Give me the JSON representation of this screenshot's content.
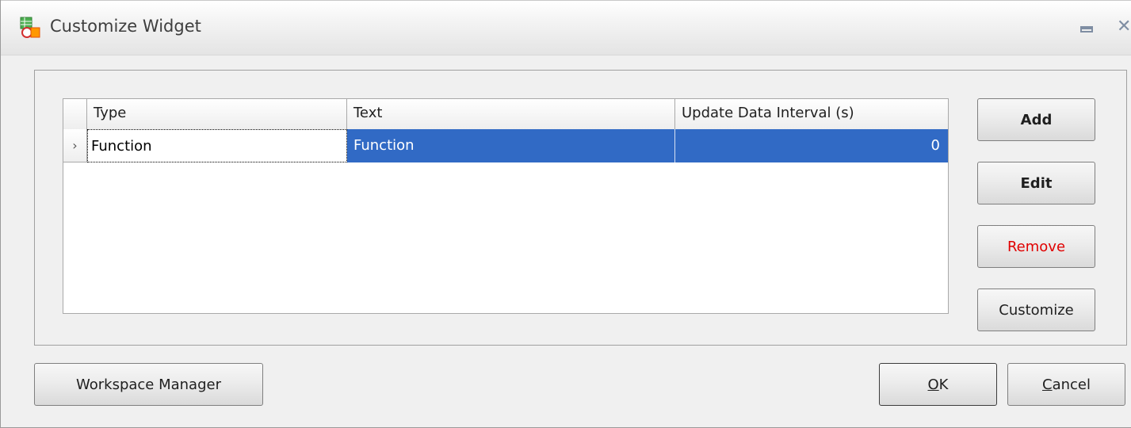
{
  "window": {
    "title": "Customize Widget",
    "icon": "widget-app-icon",
    "controls": [
      "minimize-icon",
      "close-icon"
    ]
  },
  "grid": {
    "columns": [
      "Type",
      "Text",
      "Update Data Interval (s)"
    ],
    "rows": [
      {
        "type": "Function",
        "text": "Function",
        "interval": "0",
        "selected": true
      }
    ],
    "row_indicator": "›"
  },
  "side_buttons": {
    "add": "Add",
    "edit": "Edit",
    "remove": "Remove",
    "customize": "Customize"
  },
  "footer": {
    "workspace_manager": "Workspace Manager",
    "ok_mnemonic": "O",
    "ok_rest": "K",
    "cancel_mnemonic": "C",
    "cancel_rest": "ancel"
  },
  "colors": {
    "selection": "#316ac5",
    "remove_text": "#e00000"
  }
}
